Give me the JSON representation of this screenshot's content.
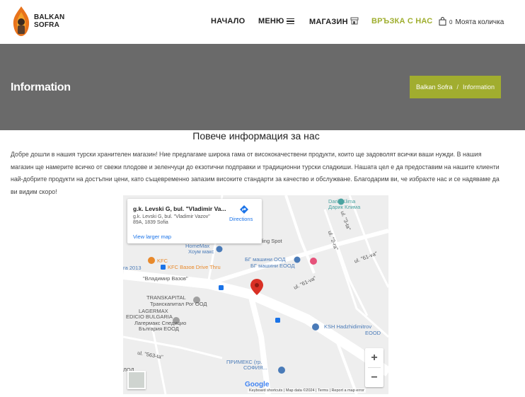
{
  "header": {
    "logo_line1": "BALKAN",
    "logo_line2": "SOFRA",
    "nav": [
      {
        "label": "НАЧАЛО"
      },
      {
        "label": "МЕНЮ"
      },
      {
        "label": "МАГАЗИН"
      },
      {
        "label": "ВРЪЗКА С НАС",
        "active": true
      }
    ],
    "cart_count": "0",
    "cart_label": "Моята количка"
  },
  "title_band": {
    "title": "Information",
    "breadcrumb": [
      "Balkan Sofra",
      "Information"
    ],
    "breadcrumb_sep": "/"
  },
  "content": {
    "heading": "Повече информация за нас",
    "intro": "Добре дошли в нашия турски хранителен магазин! Ние предлагаме широка гама от висококачествени продукти, които ще задоволят всички ваши нужди. В нашия магазин ще намерите всичко от свежи плодове и зеленчуци до екзотични подправки и традиционни турски сладкиши. Нашата цел е да предоставим на нашите клиенти най-добрите продукти на достъпни цени, като същевременно запазим високите стандарти за качество и обслужване. Благодарим ви, че избрахте нас и се надяваме да ви видим скоро!"
  },
  "map": {
    "card_title": "g.k. Levski G, bul. \"Vladimir Va...",
    "card_address": "g.k. Levski G, bul. \"Vladimir Vazov\" 89A, 1839 Sofia",
    "directions_label": "Directions",
    "view_larger": "View larger map",
    "zoom_in": "+",
    "zoom_out": "−",
    "google": "Google",
    "attribution": "Keyboard shortcuts | Map data ©2024 | Terms | Report a map error",
    "labels": {
      "darik1": "Darik Klima",
      "darik2": "Дарик Клима",
      "vending": "Vending Spot",
      "homemax1": "HomeMax",
      "homemax2": "Хоум макс",
      "bg1": "БГ машини ООД",
      "bg2": "БГ машини ЕООД",
      "kfc1": "KFC",
      "kfc2": "KFC Вазов Drive Thru",
      "ga2013": "га 2013",
      "vazov_road": "\"Владимир Вазов\"",
      "trans1": "TRANSKAPITAL",
      "trans2": "Транскапитал Рог ООД",
      "lager1": "LAGERMAX",
      "lager2": "EDICIO BULGARIA",
      "lager3": "Лагермакс Спедицио",
      "lager4": "България ЕООД",
      "ksh1": "KSH Hadzhidimitrov",
      "ksh2": "EOOD",
      "primeks1": "ПРИМЕКС (гр.",
      "primeks2": "СОФИЯ...",
      "st61": "ul. \"61-va\"",
      "st61b": "ul. \"61-va\"",
      "st2a": "ul. \"2-ra\"",
      "st3a": "ul. \"3-ta\"",
      "st563": "ul. \"563-ta\"",
      "odo": "ЛОД"
    }
  }
}
